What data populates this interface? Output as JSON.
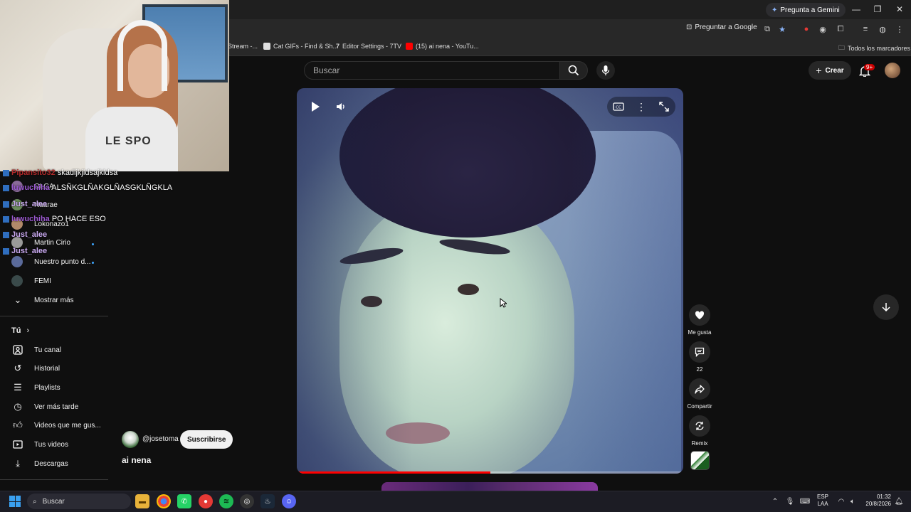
{
  "browser": {
    "gemini_button": "Pregunta a Gemini",
    "ask_google": "Preguntar a Google",
    "bookmarks": [
      {
        "label": "Stream -..."
      },
      {
        "label": "Cat GIFs - Find & Sh..."
      },
      {
        "label": "Editor Settings - 7TV"
      },
      {
        "label": "(15) ai nena - YouTu..."
      }
    ],
    "all_bookmarks": "Todos los marcadores"
  },
  "webcam": {
    "shirt_text": "LE SPO"
  },
  "chat": [
    {
      "user": "Pipansito32",
      "message": "skadljkjldsajkldsa",
      "color": "#b02a2a"
    },
    {
      "user": "luwuchiha",
      "message": "ALSÑKGLÑAKGLÑASGKLÑGKLA",
      "color": "#9b59d0"
    },
    {
      "user": "Just_alee",
      "message": "",
      "color": "#c9a9f0"
    },
    {
      "user": "luwuchiha",
      "message": "PO HACE ESO",
      "color": "#9b59d0"
    },
    {
      "user": "Just_alee",
      "message": "",
      "color": "#c9a9f0"
    },
    {
      "user": "Just_alee",
      "message": "",
      "color": "#c9a9f0"
    }
  ],
  "sidebar": {
    "subscriptions": [
      {
        "label": "OLGA"
      },
      {
        "label": "Naarae"
      },
      {
        "label": "Lokonazo1"
      },
      {
        "label": "Martin Cirio"
      },
      {
        "label": "Nuestro punto d..."
      },
      {
        "label": "FEMI"
      }
    ],
    "show_more": "Mostrar más",
    "you_heading": "Tú",
    "you_items": [
      {
        "label": "Tu canal",
        "icon": "person-icon"
      },
      {
        "label": "Historial",
        "icon": "history-icon"
      },
      {
        "label": "Playlists",
        "icon": "playlist-icon"
      },
      {
        "label": "Ver más tarde",
        "icon": "clock-icon"
      },
      {
        "label": "Videos que me gus...",
        "icon": "thumb-up-icon"
      },
      {
        "label": "Tus videos",
        "icon": "video-icon"
      },
      {
        "label": "Descargas",
        "icon": "download-icon"
      }
    ]
  },
  "header": {
    "search_placeholder": "Buscar",
    "create_label": "Crear",
    "notifications_badge": "9+"
  },
  "short": {
    "channel": "@josetoma",
    "subscribe_label": "Suscribirse",
    "title": "ai nena",
    "progress": 0.5,
    "actions": {
      "like_label": "Me gusta",
      "comments_count": "22",
      "share_label": "Compartir",
      "remix_label": "Remix"
    }
  },
  "taskbar": {
    "search_label": "Buscar",
    "lang_line1": "ESP",
    "lang_line2": "LAA",
    "time": "01:32",
    "date": "20/8/2026"
  },
  "colors": {
    "accent_red": "#ff0000",
    "link_blue": "#3ea6ff"
  }
}
